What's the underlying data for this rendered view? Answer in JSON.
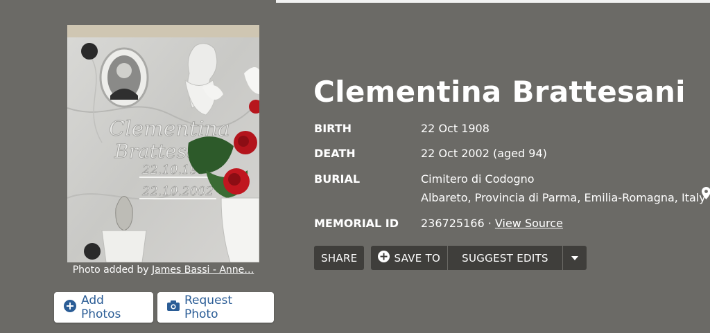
{
  "memorial": {
    "name": "Clementina Brattesani",
    "birth_label": "BIRTH",
    "birth_value": "22 Oct 1908",
    "death_label": "DEATH",
    "death_value": "22 Oct 2002 (aged 94)",
    "burial_label": "BURIAL",
    "cemetery": "Cimitero di Codogno",
    "location": "Albareto, Provincia di Parma, Emilia-Romagna, Italy",
    "memorial_id_label": "MEMORIAL ID",
    "memorial_id": "236725166",
    "id_separator": "·",
    "view_source": "View Source"
  },
  "photo": {
    "caption_prefix": "Photo added by",
    "added_by": "James Bassi - Anne…",
    "engraved_name_1": "Clementina",
    "engraved_name_2": "Brattesani",
    "engraved_date_1": "22.10.1908",
    "engraved_date_2": "22.10.2002"
  },
  "photo_actions": {
    "add_photos": "Add Photos",
    "request_photo": "Request Photo"
  },
  "actions": {
    "share": "SHARE",
    "save_to": "SAVE TO",
    "suggest_edits": "SUGGEST EDITS"
  },
  "icons": {
    "add": "plus-circle-icon",
    "camera": "camera-icon",
    "pin": "map-pin-icon",
    "dropdown": "caret-down-icon"
  },
  "colors": {
    "background": "#6b6a66",
    "button_dark": "#3f3e3b",
    "link_blue": "#2b5d96"
  }
}
